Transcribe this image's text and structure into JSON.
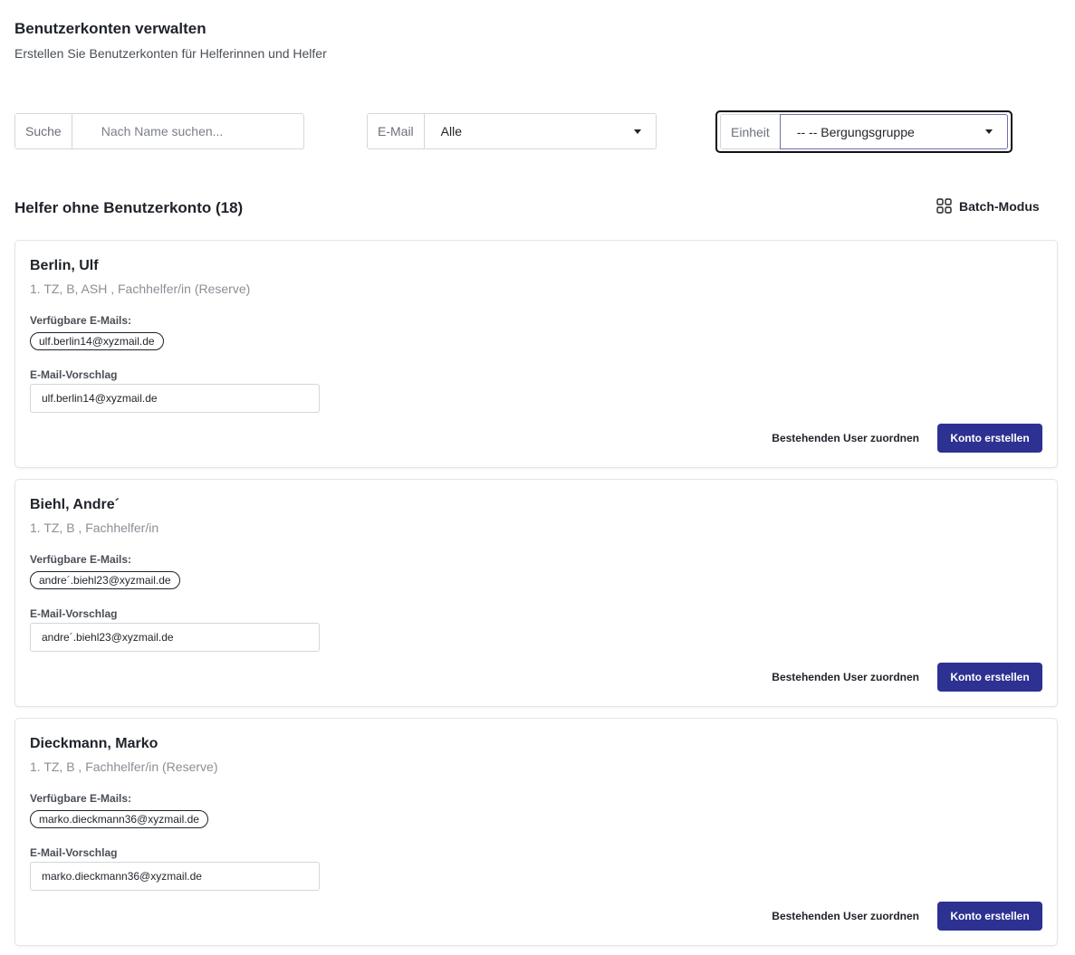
{
  "header": {
    "title": "Benutzerkonten verwalten",
    "subtitle": "Erstellen Sie Benutzerkonten für Helferinnen und Helfer"
  },
  "filters": {
    "search": {
      "label": "Suche",
      "placeholder": "Nach Name suchen...",
      "value": ""
    },
    "email": {
      "label": "E-Mail",
      "value": "Alle"
    },
    "unit": {
      "label": "Einheit",
      "value": "-- -- Bergungsgruppe"
    }
  },
  "section": {
    "title": "Helfer ohne Benutzerkonto (18)",
    "batch_label": "Batch-Modus"
  },
  "labels": {
    "available_emails": "Verfügbare E-Mails:",
    "email_suggestion": "E-Mail-Vorschlag",
    "assign_existing": "Bestehenden User zuordnen",
    "create_account": "Konto erstellen"
  },
  "helpers": [
    {
      "name": "Berlin, Ulf",
      "meta": "1. TZ, B, ASH , Fachhelfer/in (Reserve)",
      "available_email": "ulf.berlin14@xyzmail.de",
      "suggestion": "ulf.berlin14@xyzmail.de"
    },
    {
      "name": "Biehl, Andre´",
      "meta": "1. TZ, B , Fachhelfer/in",
      "available_email": "andre´.biehl23@xyzmail.de",
      "suggestion": "andre´.biehl23@xyzmail.de"
    },
    {
      "name": "Dieckmann, Marko",
      "meta": "1. TZ, B , Fachhelfer/in (Reserve)",
      "available_email": "marko.dieckmann36@xyzmail.de",
      "suggestion": "marko.dieckmann36@xyzmail.de"
    }
  ],
  "colors": {
    "primary": "#2d3191",
    "border": "#d4d6da",
    "muted_text": "#8a8f96"
  }
}
